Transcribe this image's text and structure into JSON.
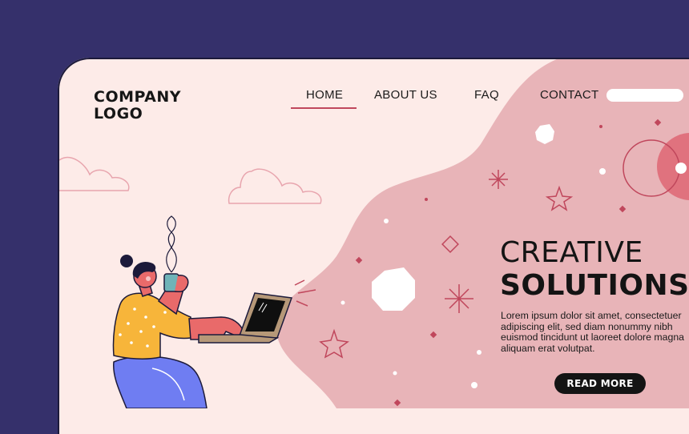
{
  "header": {
    "logo_line1": "COMPANY",
    "logo_line2": "LOGO",
    "nav": [
      {
        "label": "HOME",
        "active": true
      },
      {
        "label": "ABOUT US",
        "active": false
      },
      {
        "label": "FAQ",
        "active": false
      },
      {
        "label": "CONTACT",
        "active": false
      }
    ]
  },
  "hero": {
    "title_line1": "CREATIVE",
    "title_line2": "SOLUTIONS",
    "body": "Lorem ipsum dolor sit amet, consectetuer adipiscing elit, sed diam nonummy nibh euismod tincidunt ut laoreet dolore magna aliquam erat volutpat.",
    "cta_label": "READ MORE"
  },
  "colors": {
    "frame": "#35306b",
    "page_background": "#fdebe8",
    "blob": "#e8b4b8",
    "accent": "#c0475c",
    "active_underline": "#c0475c"
  },
  "illustration": {
    "subject": "person-with-laptop-and-coffee-icon"
  }
}
